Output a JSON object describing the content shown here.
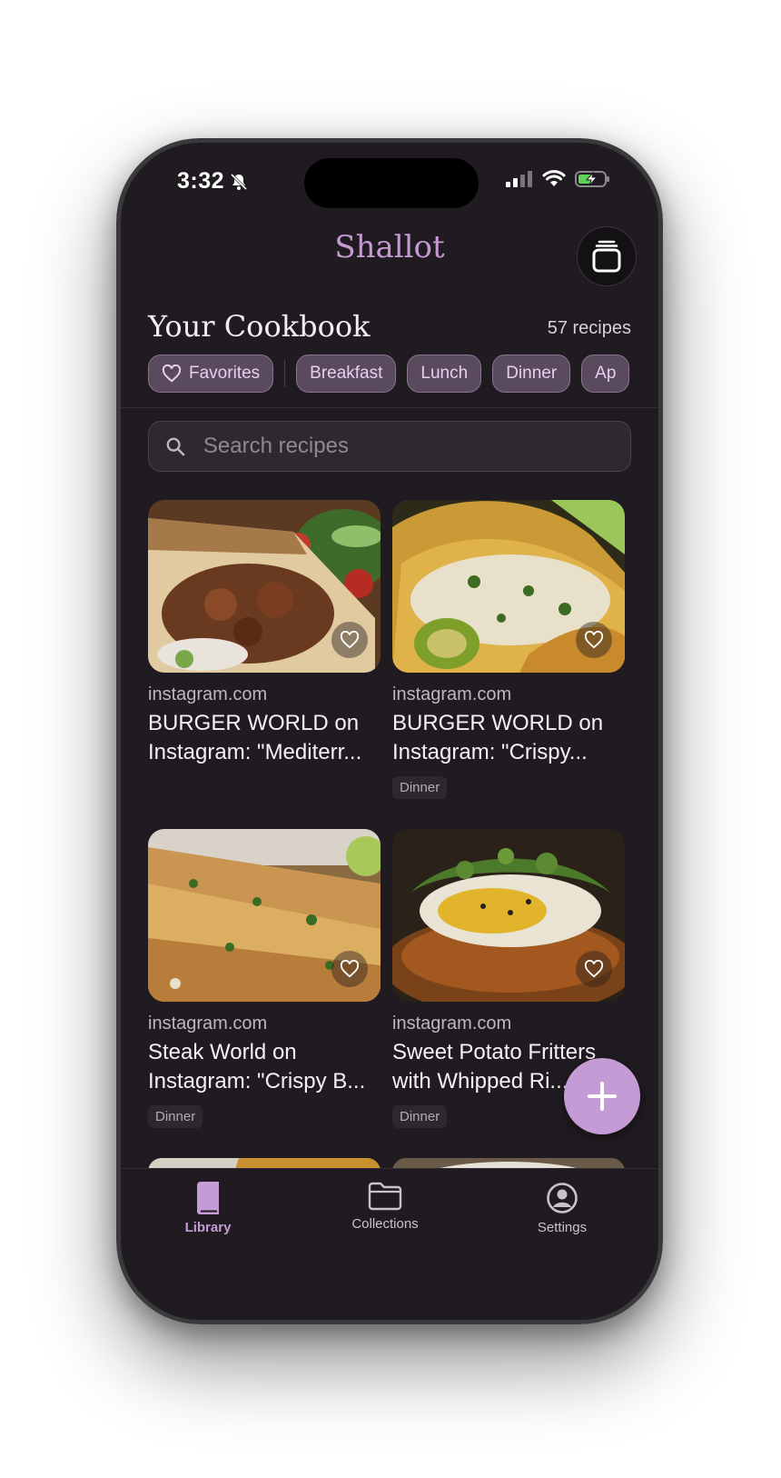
{
  "status": {
    "time": "3:32"
  },
  "header": {
    "app_title": "Shallot"
  },
  "cookbook": {
    "title": "Your Cookbook",
    "count": "57 recipes"
  },
  "chips": [
    {
      "label": "Favorites",
      "icon": "heart-icon"
    },
    {
      "label": "Breakfast"
    },
    {
      "label": "Lunch"
    },
    {
      "label": "Dinner"
    },
    {
      "label": "Ap"
    }
  ],
  "search": {
    "placeholder": "Search recipes"
  },
  "recipes": [
    {
      "source": "instagram.com",
      "title_line1": "BURGER WORLD on",
      "title_line2": "Instagram: \"Mediterr...",
      "tag": ""
    },
    {
      "source": "instagram.com",
      "title_line1": "BURGER WORLD on",
      "title_line2": "Instagram: \"Crispy...",
      "tag": "Dinner"
    },
    {
      "source": "instagram.com",
      "title_line1": "Steak World on",
      "title_line2": "Instagram: \"Crispy B...",
      "tag": "Dinner"
    },
    {
      "source": "instagram.com",
      "title_line1": "Sweet Potato Fritters",
      "title_line2": "with Whipped Ri...",
      "tag": "Dinner"
    }
  ],
  "tabs": [
    {
      "label": "Library",
      "icon": "book-icon",
      "active": true
    },
    {
      "label": "Collections",
      "icon": "folder-icon",
      "active": false
    },
    {
      "label": "Settings",
      "icon": "profile-icon",
      "active": false
    }
  ],
  "colors": {
    "accent": "#c59bd6",
    "background": "#1f1b20",
    "chip": "#5a4a5e"
  }
}
